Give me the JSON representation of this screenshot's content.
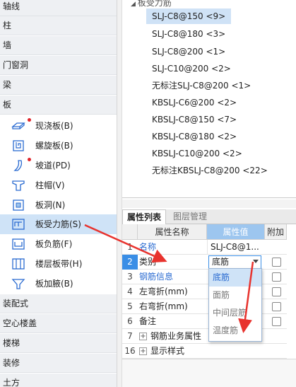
{
  "sidebar": {
    "categories": {
      "axis": "轴线",
      "column": "柱",
      "wall": "墙",
      "door_window": "门窗洞",
      "beam": "梁",
      "slab": "板",
      "assembly": "装配式",
      "hollow_floor": "空心楼盖",
      "stair": "楼梯",
      "decoration": "装修",
      "earthwork": "土方"
    },
    "slab_items": [
      {
        "label": "现浇板(B)",
        "icon": "cast-slab-icon"
      },
      {
        "label": "螺旋板(B)",
        "icon": "spiral-slab-icon"
      },
      {
        "label": "坡道(PD)",
        "icon": "ramp-icon"
      },
      {
        "label": "柱帽(V)",
        "icon": "column-cap-icon"
      },
      {
        "label": "板洞(N)",
        "icon": "slab-hole-icon"
      },
      {
        "label": "板受力筋(S)",
        "icon": "slab-rebar-icon"
      },
      {
        "label": "板负筋(F)",
        "icon": "negative-rebar-icon"
      },
      {
        "label": "楼层板带(H)",
        "icon": "floor-strip-icon"
      },
      {
        "label": "板加腋(B)",
        "icon": "haunch-icon"
      }
    ]
  },
  "tree": {
    "partial_label": "板受力筋",
    "nodes": [
      "SLJ-C8@150 <9>",
      "SLJ-C8@180 <3>",
      "SLJ-C8@200 <1>",
      "SLJ-C10@200 <2>",
      "无标注SLJ-C8@200 <1>",
      "KBSLJ-C6@200 <2>",
      "KBSLJ-C8@150 <7>",
      "KBSLJ-C8@180 <2>",
      "KBSLJ-C10@200 <2>",
      "无标注KBSLJ-C8@200 <22>"
    ]
  },
  "tabs": {
    "properties": "属性列表",
    "layers": "图层管理"
  },
  "grid": {
    "headers": {
      "name": "属性名称",
      "value": "属性值",
      "extra": "附加"
    },
    "rows": [
      {
        "num": "1",
        "name": "名称",
        "value": "SLJ-C8@1..."
      },
      {
        "num": "2",
        "name": "类别",
        "value": "底筋"
      },
      {
        "num": "3",
        "name": "钢筋信息",
        "value": ""
      },
      {
        "num": "4",
        "name": "左弯折(mm)",
        "value": ""
      },
      {
        "num": "5",
        "name": "右弯折(mm)",
        "value": ""
      },
      {
        "num": "6",
        "name": "备注",
        "value": ""
      },
      {
        "num": "7",
        "name": "钢筋业务属性",
        "value": ""
      },
      {
        "num": "16",
        "name": "显示样式",
        "value": ""
      }
    ],
    "expander_symbol": "+"
  },
  "dropdown": {
    "selected": "底筋",
    "options": [
      "底筋",
      "面筋",
      "中间层筋",
      "温度筋"
    ]
  },
  "colors": {
    "accent": "#3a8ee6",
    "arrow": "#e8332e",
    "selection": "#cfe3f7"
  }
}
